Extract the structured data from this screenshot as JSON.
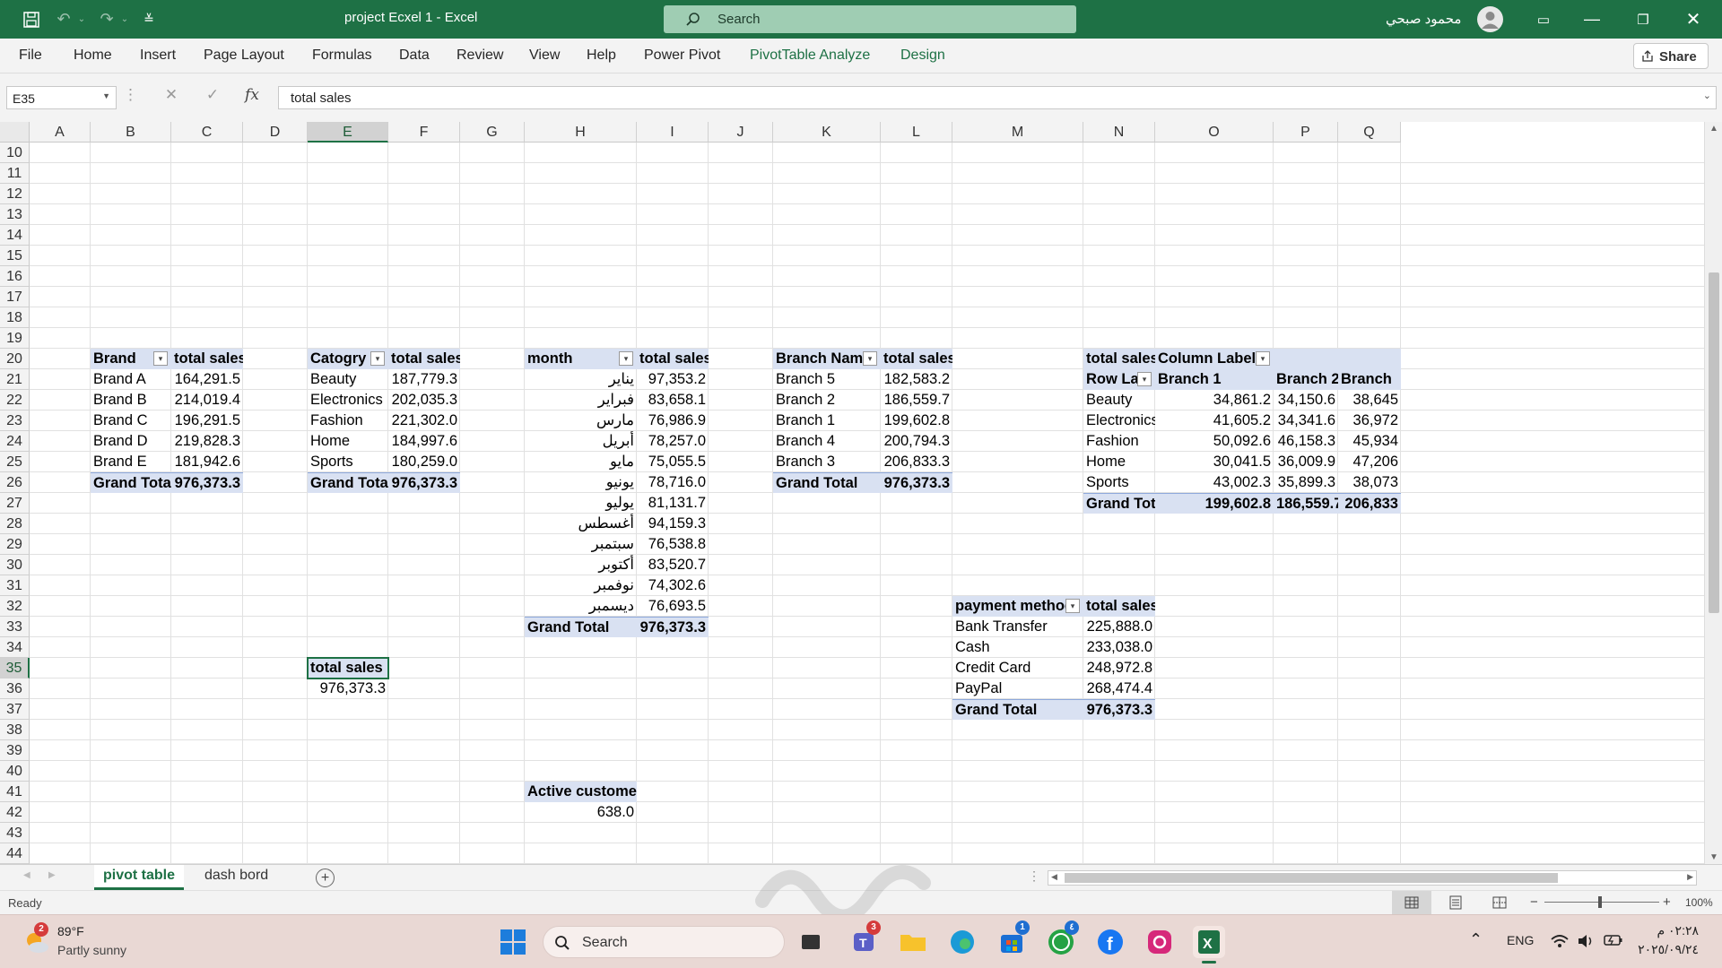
{
  "window": {
    "title": "project Ecxel 1  -  Excel",
    "search_placeholder": "Search",
    "user": "محمود صبحي"
  },
  "ribbon": {
    "tabs": [
      "File",
      "Home",
      "Insert",
      "Page Layout",
      "Formulas",
      "Data",
      "Review",
      "View",
      "Help",
      "Power Pivot"
    ],
    "context_tabs": [
      "PivotTable Analyze",
      "Design"
    ],
    "share_label": "Share"
  },
  "formula_bar": {
    "name_box": "E35",
    "formula": "total sales",
    "fx_label": "fx"
  },
  "columns": [
    "A",
    "B",
    "C",
    "D",
    "E",
    "F",
    "G",
    "H",
    "I",
    "J",
    "K",
    "L",
    "M",
    "N",
    "O",
    "P",
    "Q"
  ],
  "rows": [
    "10",
    "11",
    "12",
    "13",
    "14",
    "15",
    "16",
    "17",
    "18",
    "19",
    "20",
    "21",
    "22",
    "23",
    "24",
    "25",
    "26",
    "27",
    "28",
    "29",
    "30",
    "31",
    "32",
    "33",
    "34",
    "35",
    "36",
    "37",
    "38",
    "39",
    "40",
    "41",
    "42",
    "43",
    "44"
  ],
  "pivot_brand": {
    "h1": "Brand",
    "h2": "total sales",
    "rows": [
      [
        "Brand A",
        "164,291.5"
      ],
      [
        "Brand B",
        "214,019.4"
      ],
      [
        "Brand C",
        "196,291.5"
      ],
      [
        "Brand D",
        "219,828.3"
      ],
      [
        "Brand E",
        "181,942.6"
      ]
    ],
    "total_label": "Grand Total",
    "total": "976,373.3"
  },
  "pivot_category": {
    "h1": "Catogry",
    "h2": "total sales",
    "rows": [
      [
        "Beauty",
        "187,779.3"
      ],
      [
        "Electronics",
        "202,035.3"
      ],
      [
        "Fashion",
        "221,302.0"
      ],
      [
        "Home",
        "184,997.6"
      ],
      [
        "Sports",
        "180,259.0"
      ]
    ],
    "total_label": "Grand Total",
    "total": "976,373.3"
  },
  "pivot_month": {
    "h1": "month",
    "h2": "total sales",
    "rows": [
      [
        "يناير",
        "97,353.2"
      ],
      [
        "فبراير",
        "83,658.1"
      ],
      [
        "مارس",
        "76,986.9"
      ],
      [
        "أبريل",
        "78,257.0"
      ],
      [
        "مايو",
        "75,055.5"
      ],
      [
        "يونيو",
        "78,716.0"
      ],
      [
        "يوليو",
        "81,131.7"
      ],
      [
        "أغسطس",
        "94,159.3"
      ],
      [
        "سبتمبر",
        "76,538.8"
      ],
      [
        "أكتوبر",
        "83,520.7"
      ],
      [
        "نوفمبر",
        "74,302.6"
      ],
      [
        "ديسمبر",
        "76,693.5"
      ]
    ],
    "total_label": "Grand Total",
    "total": "976,373.3"
  },
  "pivot_branch": {
    "h1": "Branch Name",
    "h2": "total sales",
    "rows": [
      [
        "Branch 5",
        "182,583.2"
      ],
      [
        "Branch 2",
        "186,559.7"
      ],
      [
        "Branch 1",
        "199,602.8"
      ],
      [
        "Branch 4",
        "200,794.3"
      ],
      [
        "Branch 3",
        "206,833.3"
      ]
    ],
    "total_label": "Grand Total",
    "total": "976,373.3"
  },
  "pivot_cross": {
    "corner": "total sales",
    "col_labels": "Column Labels",
    "row_labels": "Row Lab",
    "cols": [
      "Branch 1",
      "Branch 2",
      "Branch"
    ],
    "rows": [
      [
        "Beauty",
        "34,861.2",
        "34,150.6",
        "38,645"
      ],
      [
        "Electronics",
        "41,605.2",
        "34,341.6",
        "36,972"
      ],
      [
        "Fashion",
        "50,092.6",
        "46,158.3",
        "45,934"
      ],
      [
        "Home",
        "30,041.5",
        "36,009.9",
        "47,206"
      ],
      [
        "Sports",
        "43,002.3",
        "35,899.3",
        "38,073"
      ]
    ],
    "total_label": "Grand Tota",
    "totals": [
      "199,602.8",
      "186,559.7",
      "206,833"
    ]
  },
  "pivot_payment": {
    "h1": "payment method",
    "h2": "total sales",
    "rows": [
      [
        "Bank Transfer",
        "225,888.0"
      ],
      [
        "Cash",
        "233,038.0"
      ],
      [
        "Credit Card",
        "248,972.8"
      ],
      [
        "PayPal",
        "268,474.4"
      ]
    ],
    "total_label": "Grand Total",
    "total": "976,373.3"
  },
  "pivot_total": {
    "h": "total sales",
    "v": "976,373.3"
  },
  "pivot_active": {
    "h": "Active customer",
    "v": "638.0"
  },
  "sheets": [
    "pivot table",
    "dash bord"
  ],
  "status": {
    "ready": "Ready",
    "zoom": "100%"
  },
  "taskbar": {
    "weather_temp": "89°F",
    "weather_desc": "Partly sunny",
    "weather_badge": "2",
    "search": "Search",
    "lang": "ENG",
    "time": "٠٢:٢٨ م",
    "date": "٢٠٢٥/٠٩/٢٤",
    "teams_badge": "3",
    "store_badge": "1",
    "whatsapp_badge": "٤"
  },
  "watermark": "مستقل"
}
